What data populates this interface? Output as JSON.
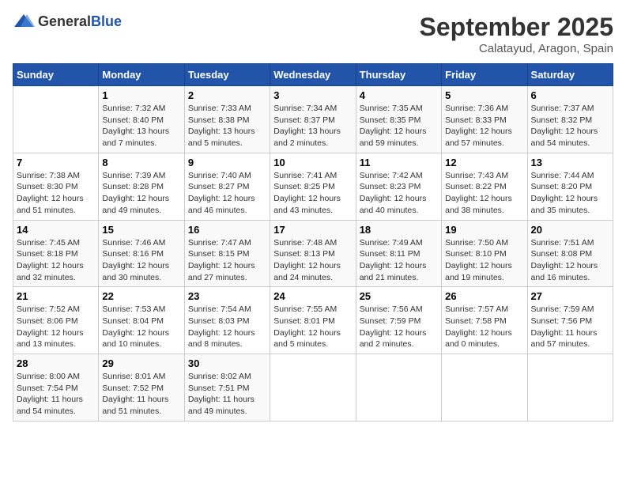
{
  "header": {
    "logo_general": "General",
    "logo_blue": "Blue",
    "month": "September 2025",
    "location": "Calatayud, Aragon, Spain"
  },
  "days_of_week": [
    "Sunday",
    "Monday",
    "Tuesday",
    "Wednesday",
    "Thursday",
    "Friday",
    "Saturday"
  ],
  "weeks": [
    [
      {
        "day": "",
        "info": ""
      },
      {
        "day": "1",
        "info": "Sunrise: 7:32 AM\nSunset: 8:40 PM\nDaylight: 13 hours and 7 minutes."
      },
      {
        "day": "2",
        "info": "Sunrise: 7:33 AM\nSunset: 8:38 PM\nDaylight: 13 hours and 5 minutes."
      },
      {
        "day": "3",
        "info": "Sunrise: 7:34 AM\nSunset: 8:37 PM\nDaylight: 13 hours and 2 minutes."
      },
      {
        "day": "4",
        "info": "Sunrise: 7:35 AM\nSunset: 8:35 PM\nDaylight: 12 hours and 59 minutes."
      },
      {
        "day": "5",
        "info": "Sunrise: 7:36 AM\nSunset: 8:33 PM\nDaylight: 12 hours and 57 minutes."
      },
      {
        "day": "6",
        "info": "Sunrise: 7:37 AM\nSunset: 8:32 PM\nDaylight: 12 hours and 54 minutes."
      }
    ],
    [
      {
        "day": "7",
        "info": "Sunrise: 7:38 AM\nSunset: 8:30 PM\nDaylight: 12 hours and 51 minutes."
      },
      {
        "day": "8",
        "info": "Sunrise: 7:39 AM\nSunset: 8:28 PM\nDaylight: 12 hours and 49 minutes."
      },
      {
        "day": "9",
        "info": "Sunrise: 7:40 AM\nSunset: 8:27 PM\nDaylight: 12 hours and 46 minutes."
      },
      {
        "day": "10",
        "info": "Sunrise: 7:41 AM\nSunset: 8:25 PM\nDaylight: 12 hours and 43 minutes."
      },
      {
        "day": "11",
        "info": "Sunrise: 7:42 AM\nSunset: 8:23 PM\nDaylight: 12 hours and 40 minutes."
      },
      {
        "day": "12",
        "info": "Sunrise: 7:43 AM\nSunset: 8:22 PM\nDaylight: 12 hours and 38 minutes."
      },
      {
        "day": "13",
        "info": "Sunrise: 7:44 AM\nSunset: 8:20 PM\nDaylight: 12 hours and 35 minutes."
      }
    ],
    [
      {
        "day": "14",
        "info": "Sunrise: 7:45 AM\nSunset: 8:18 PM\nDaylight: 12 hours and 32 minutes."
      },
      {
        "day": "15",
        "info": "Sunrise: 7:46 AM\nSunset: 8:16 PM\nDaylight: 12 hours and 30 minutes."
      },
      {
        "day": "16",
        "info": "Sunrise: 7:47 AM\nSunset: 8:15 PM\nDaylight: 12 hours and 27 minutes."
      },
      {
        "day": "17",
        "info": "Sunrise: 7:48 AM\nSunset: 8:13 PM\nDaylight: 12 hours and 24 minutes."
      },
      {
        "day": "18",
        "info": "Sunrise: 7:49 AM\nSunset: 8:11 PM\nDaylight: 12 hours and 21 minutes."
      },
      {
        "day": "19",
        "info": "Sunrise: 7:50 AM\nSunset: 8:10 PM\nDaylight: 12 hours and 19 minutes."
      },
      {
        "day": "20",
        "info": "Sunrise: 7:51 AM\nSunset: 8:08 PM\nDaylight: 12 hours and 16 minutes."
      }
    ],
    [
      {
        "day": "21",
        "info": "Sunrise: 7:52 AM\nSunset: 8:06 PM\nDaylight: 12 hours and 13 minutes."
      },
      {
        "day": "22",
        "info": "Sunrise: 7:53 AM\nSunset: 8:04 PM\nDaylight: 12 hours and 10 minutes."
      },
      {
        "day": "23",
        "info": "Sunrise: 7:54 AM\nSunset: 8:03 PM\nDaylight: 12 hours and 8 minutes."
      },
      {
        "day": "24",
        "info": "Sunrise: 7:55 AM\nSunset: 8:01 PM\nDaylight: 12 hours and 5 minutes."
      },
      {
        "day": "25",
        "info": "Sunrise: 7:56 AM\nSunset: 7:59 PM\nDaylight: 12 hours and 2 minutes."
      },
      {
        "day": "26",
        "info": "Sunrise: 7:57 AM\nSunset: 7:58 PM\nDaylight: 12 hours and 0 minutes."
      },
      {
        "day": "27",
        "info": "Sunrise: 7:59 AM\nSunset: 7:56 PM\nDaylight: 11 hours and 57 minutes."
      }
    ],
    [
      {
        "day": "28",
        "info": "Sunrise: 8:00 AM\nSunset: 7:54 PM\nDaylight: 11 hours and 54 minutes."
      },
      {
        "day": "29",
        "info": "Sunrise: 8:01 AM\nSunset: 7:52 PM\nDaylight: 11 hours and 51 minutes."
      },
      {
        "day": "30",
        "info": "Sunrise: 8:02 AM\nSunset: 7:51 PM\nDaylight: 11 hours and 49 minutes."
      },
      {
        "day": "",
        "info": ""
      },
      {
        "day": "",
        "info": ""
      },
      {
        "day": "",
        "info": ""
      },
      {
        "day": "",
        "info": ""
      }
    ]
  ]
}
